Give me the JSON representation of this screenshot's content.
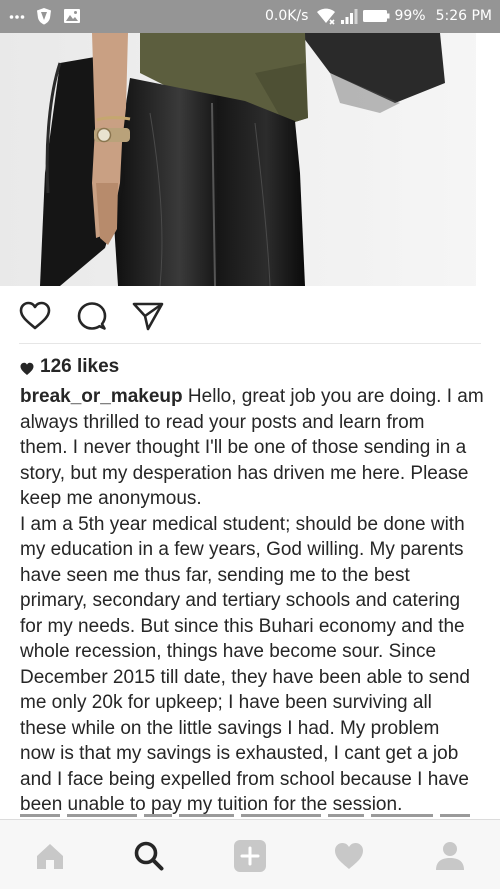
{
  "status_bar": {
    "icons": [
      "more-dots-icon",
      "shield-icon",
      "image-icon"
    ],
    "network_speed": "0.0K/s",
    "battery": "99%",
    "time": "5:26 PM",
    "right_icons": [
      "wifi-icon",
      "signal-icon",
      "battery-icon"
    ]
  },
  "post": {
    "image": "leather-skirt-photo",
    "actions": [
      "heart-icon",
      "comment-icon",
      "share-icon"
    ],
    "likes": "126 likes",
    "username": "break_or_makeup",
    "caption_lines_p1": [
      " Hello, great job you are doing. I am",
      "always thrilled to read your posts and learn from",
      "them. I never thought I'll be one of those sending in a",
      "story, but my desperation has driven me here. Please",
      "keep me anonymous."
    ],
    "caption_lines_p2": [
      "I am a 5th year medical student; should be done with",
      "my education in a few years, God willing. My parents",
      "have seen me thus far, sending me to the best",
      "primary, secondary and tertiary schools and catering",
      "for my needs. But since this Buhari economy and the",
      "whole recession, things have become sour. Since",
      "December 2015 till date, they have been able to send",
      "me only 20k for upkeep; I have been surviving all",
      "these while on the little savings I had. My problem",
      "now is that my savings is exhausted, I cant get a job",
      "and I face being expelled from school because I have",
      "been unable to pay my tuition for the session."
    ]
  },
  "bottom_nav": {
    "tabs": [
      "home-icon",
      "search-icon",
      "add-post-icon",
      "activity-heart-icon",
      "profile-icon"
    ],
    "active_tab": "search-icon",
    "colors": {
      "inactive": "#c8c8c8",
      "active": "#262626"
    }
  }
}
